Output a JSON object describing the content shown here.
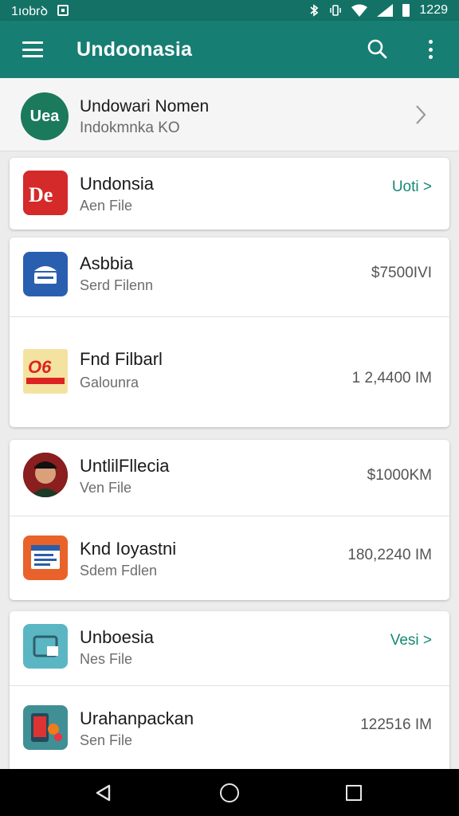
{
  "status_bar": {
    "left_text": "1ıobrꝺ",
    "time": "1229"
  },
  "app_bar": {
    "title": "Undoonasia"
  },
  "profile": {
    "avatar_text": "Uea",
    "name": "Undowari Nomen",
    "subtitle": "Indokmnka KO"
  },
  "cards": [
    {
      "rows": [
        {
          "name": "Undonsia",
          "sub": "Aen File",
          "link": "Uoti",
          "link_suffix": " >"
        }
      ]
    },
    {
      "rows": [
        {
          "name": "Asbbia",
          "sub": "Serd Filenn",
          "value": "$7500IVI"
        },
        {
          "name": "Fnd Filbarl",
          "sub": "Galounra",
          "value": "1 2,4400 IM"
        }
      ]
    },
    {
      "rows": [
        {
          "name": "UntlilFllecia",
          "sub": "Ven File",
          "value": "$1000KM"
        },
        {
          "name": "Knd Ioyastni",
          "sub": "Sdem Fdlen",
          "value": "180,2240 IM"
        }
      ]
    },
    {
      "rows": [
        {
          "name": "Unboesia",
          "sub": "Nes File",
          "link": "Vesi",
          "link_suffix": " >"
        },
        {
          "name": "Urahanpackan",
          "sub": "Sen File",
          "value": "122516 IM"
        }
      ]
    }
  ],
  "icons": {
    "menu": "menu-icon",
    "search": "search-icon",
    "more": "more-vertical-icon",
    "chevron": "chevron-right-icon",
    "back": "back-triangle-icon",
    "home": "home-circle-icon",
    "recents": "recents-square-icon"
  },
  "colors": {
    "primary": "#177e73",
    "status_bar": "#137166",
    "accent_link": "#138a75"
  }
}
